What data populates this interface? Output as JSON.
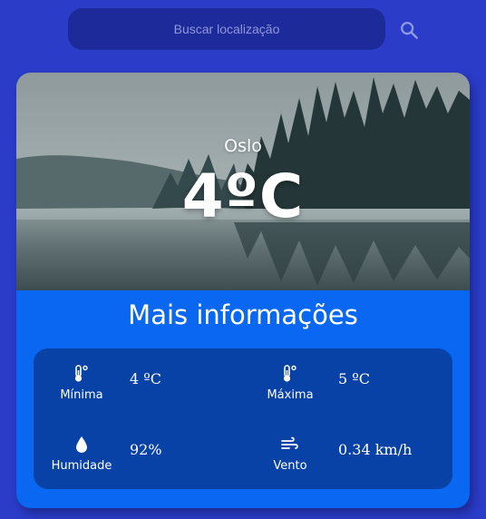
{
  "search": {
    "placeholder": "Buscar localização",
    "value": ""
  },
  "icons": {
    "search": "search-icon",
    "thermometer": "thermometer-icon",
    "humidity": "droplet-icon",
    "wind": "wind-icon"
  },
  "colors": {
    "background": "#2b3cc8",
    "search_bg": "#1c2a9a",
    "card_bg": "#0a67f2",
    "panel_bg": "#0842a6",
    "text": "#ffffff"
  },
  "weather": {
    "city": "Oslo",
    "temperature": "4ºC"
  },
  "details": {
    "title": "Mais informações",
    "min": {
      "label": "Mínima",
      "value": "4 ºC"
    },
    "max": {
      "label": "Máxima",
      "value": "5 ºC"
    },
    "humidity": {
      "label": "Humidade",
      "value": "92%"
    },
    "wind": {
      "label": "Vento",
      "value": "0.34 km/h"
    }
  }
}
